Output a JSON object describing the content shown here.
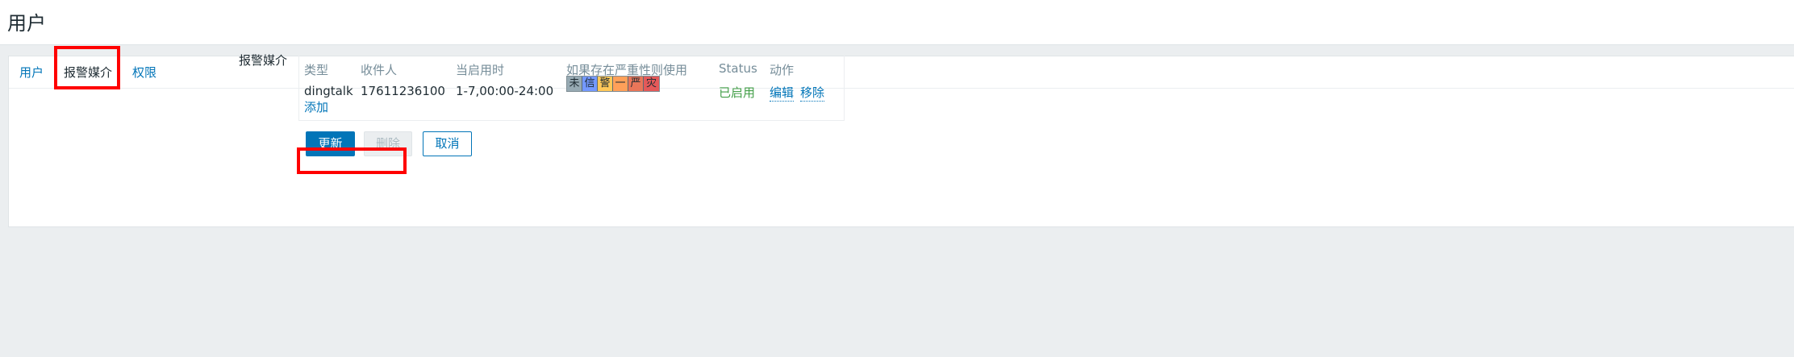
{
  "page": {
    "title": "用户"
  },
  "tabs": [
    {
      "label": "用户"
    },
    {
      "label": "报警媒介"
    },
    {
      "label": "权限"
    }
  ],
  "media_form": {
    "label": "报警媒介",
    "table": {
      "headers": [
        "类型",
        "收件人",
        "当启用时",
        "如果存在严重性则使用",
        "Status",
        "动作"
      ],
      "rows": [
        {
          "type": "dingtalk",
          "recipient": "17611236100",
          "when_active": "1-7,00:00-24:00",
          "severities": [
            "未",
            "信",
            "警",
            "一",
            "严",
            "灾"
          ],
          "status": "已启用",
          "actions": [
            "编辑",
            "移除"
          ]
        }
      ]
    },
    "add_label": "添加"
  },
  "buttons": {
    "update": "更新",
    "delete": "删除",
    "cancel": "取消"
  },
  "colors": {
    "accent": "#0275b8",
    "status_enabled": "#429e47",
    "highlight": "#ff0000",
    "severity": [
      "#97aab3",
      "#7499ff",
      "#ffc859",
      "#ffa059",
      "#e97659",
      "#e45959"
    ]
  }
}
